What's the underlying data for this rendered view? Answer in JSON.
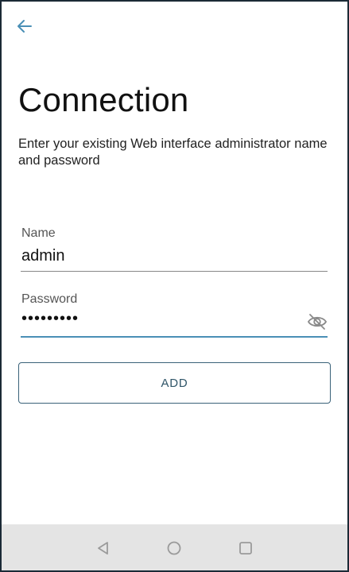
{
  "header": {
    "back_icon": "arrow-left-icon",
    "accent_color": "#4a8fb6"
  },
  "page": {
    "title": "Connection",
    "subtitle": "Enter your existing Web interface administrator name and password"
  },
  "form": {
    "name": {
      "label": "Name",
      "value": "admin"
    },
    "password": {
      "label": "Password",
      "value": "•••••••••",
      "toggle_icon": "eye-off-icon"
    },
    "submit_label": "ADD"
  },
  "system_nav": {
    "back_icon": "triangle-back-icon",
    "home_icon": "circle-home-icon",
    "recents_icon": "square-recents-icon"
  }
}
